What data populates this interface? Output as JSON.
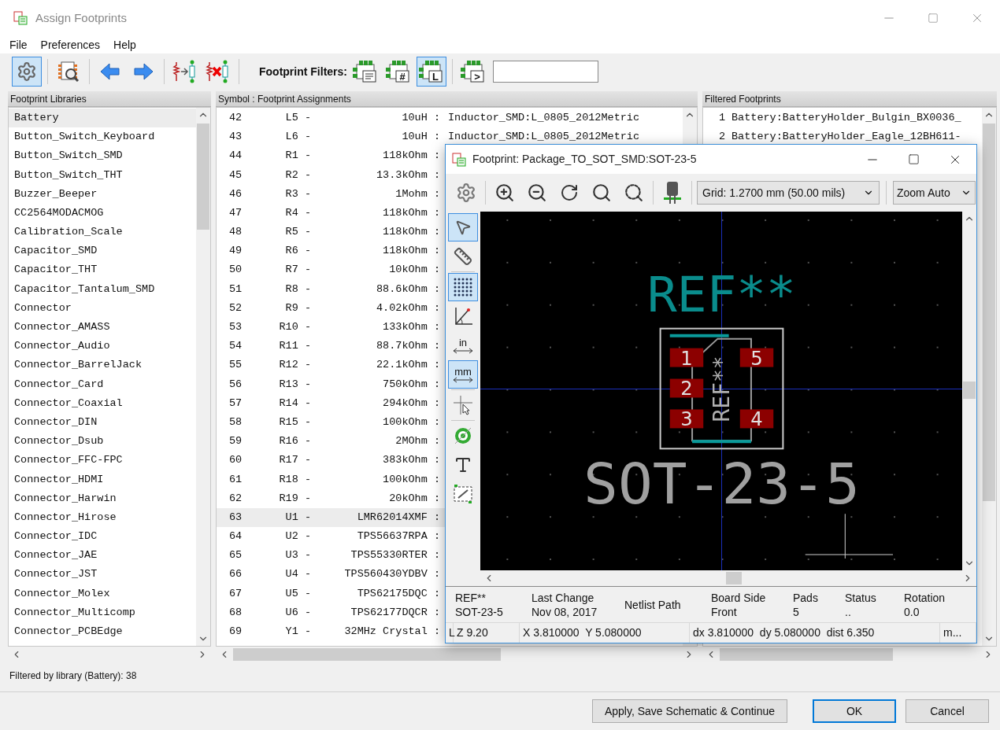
{
  "window": {
    "title": "Assign Footprints"
  },
  "menu": [
    "File",
    "Preferences",
    "Help"
  ],
  "toolbar": {
    "buttons": [
      {
        "kind": "settings",
        "selected": true
      },
      {
        "kind": "viewer",
        "selected": false
      },
      {
        "kind": "previous",
        "selected": false
      },
      {
        "kind": "next",
        "selected": false
      },
      {
        "kind": "associate",
        "selected": false
      },
      {
        "kind": "delete",
        "selected": false
      }
    ],
    "filter_label": "Footprint Filters:",
    "filters": [
      {
        "kind": "lines",
        "selected": false
      },
      {
        "kind": "glyph",
        "glyph": "#",
        "selected": false
      },
      {
        "kind": "glyph",
        "glyph": "L",
        "selected": true
      },
      {
        "kind": "glyph",
        "glyph": ">",
        "selected": false
      }
    ]
  },
  "libraries": {
    "header": "Footprint Libraries",
    "items": [
      {
        "name": "Battery",
        "selected": true
      },
      {
        "name": "Button_Switch_Keyboard",
        "selected": false
      },
      {
        "name": "Button_Switch_SMD",
        "selected": false
      },
      {
        "name": "Button_Switch_THT",
        "selected": false
      },
      {
        "name": "Buzzer_Beeper",
        "selected": false
      },
      {
        "name": "CC2564MODACMOG",
        "selected": false
      },
      {
        "name": "Calibration_Scale",
        "selected": false
      },
      {
        "name": "Capacitor_SMD",
        "selected": false
      },
      {
        "name": "Capacitor_THT",
        "selected": false
      },
      {
        "name": "Capacitor_Tantalum_SMD",
        "selected": false
      },
      {
        "name": "Connector",
        "selected": false
      },
      {
        "name": "Connector_AMASS",
        "selected": false
      },
      {
        "name": "Connector_Audio",
        "selected": false
      },
      {
        "name": "Connector_BarrelJack",
        "selected": false
      },
      {
        "name": "Connector_Card",
        "selected": false
      },
      {
        "name": "Connector_Coaxial",
        "selected": false
      },
      {
        "name": "Connector_DIN",
        "selected": false
      },
      {
        "name": "Connector_Dsub",
        "selected": false
      },
      {
        "name": "Connector_FFC-FPC",
        "selected": false
      },
      {
        "name": "Connector_HDMI",
        "selected": false
      },
      {
        "name": "Connector_Harwin",
        "selected": false
      },
      {
        "name": "Connector_Hirose",
        "selected": false
      },
      {
        "name": "Connector_IDC",
        "selected": false
      },
      {
        "name": "Connector_JAE",
        "selected": false
      },
      {
        "name": "Connector_JST",
        "selected": false
      },
      {
        "name": "Connector_Molex",
        "selected": false
      },
      {
        "name": "Connector_Multicomp",
        "selected": false
      },
      {
        "name": "Connector_PCBEdge",
        "selected": false
      }
    ]
  },
  "assignments": {
    "header": "Symbol : Footprint Assignments",
    "rows": [
      {
        "index": "42",
        "ref": "L5 -",
        "value": "10uH :",
        "footprint": "Inductor_SMD:L_0805_2012Metric",
        "selected": false
      },
      {
        "index": "43",
        "ref": "L6 -",
        "value": "10uH :",
        "footprint": "Inductor_SMD:L_0805_2012Metric",
        "selected": false
      },
      {
        "index": "44",
        "ref": "R1 -",
        "value": "118kOhm :",
        "selected": false
      },
      {
        "index": "45",
        "ref": "R2 -",
        "value": "13.3kOhm :",
        "selected": false
      },
      {
        "index": "46",
        "ref": "R3 -",
        "value": "1Mohm :",
        "selected": false
      },
      {
        "index": "47",
        "ref": "R4 -",
        "value": "118kOhm :",
        "selected": false
      },
      {
        "index": "48",
        "ref": "R5 -",
        "value": "118kOhm :",
        "selected": false
      },
      {
        "index": "49",
        "ref": "R6 -",
        "value": "118kOhm :",
        "selected": false
      },
      {
        "index": "50",
        "ref": "R7 -",
        "value": "10kOhm :",
        "selected": false
      },
      {
        "index": "51",
        "ref": "R8 -",
        "value": "88.6kOhm :",
        "selected": false
      },
      {
        "index": "52",
        "ref": "R9 -",
        "value": "4.02kOhm :",
        "selected": false
      },
      {
        "index": "53",
        "ref": "R10 -",
        "value": "133kOhm :",
        "selected": false
      },
      {
        "index": "54",
        "ref": "R11 -",
        "value": "88.7kOhm :",
        "selected": false
      },
      {
        "index": "55",
        "ref": "R12 -",
        "value": "22.1kOhm :",
        "selected": false
      },
      {
        "index": "56",
        "ref": "R13 -",
        "value": "750kOhm :",
        "selected": false
      },
      {
        "index": "57",
        "ref": "R14 -",
        "value": "294kOhm :",
        "selected": false
      },
      {
        "index": "58",
        "ref": "R15 -",
        "value": "100kOhm :",
        "selected": false
      },
      {
        "index": "59",
        "ref": "R16 -",
        "value": "2MOhm :",
        "selected": false
      },
      {
        "index": "60",
        "ref": "R17 -",
        "value": "383kOhm :",
        "selected": false
      },
      {
        "index": "61",
        "ref": "R18 -",
        "value": "100kOhm :",
        "selected": false
      },
      {
        "index": "62",
        "ref": "R19 -",
        "value": "20kOhm :",
        "selected": false
      },
      {
        "index": "63",
        "ref": "U1 -",
        "value": "LMR62014XMF :",
        "selected": true
      },
      {
        "index": "64",
        "ref": "U2 -",
        "value": "TPS56637RPA :",
        "selected": false
      },
      {
        "index": "65",
        "ref": "U3 -",
        "value": "TPS55330RTER :",
        "selected": false
      },
      {
        "index": "66",
        "ref": "U4 -",
        "value": "TPS560430YDBV :",
        "selected": false
      },
      {
        "index": "67",
        "ref": "U5 -",
        "value": "TPS62175DQC :",
        "selected": false
      },
      {
        "index": "68",
        "ref": "U6 -",
        "value": "TPS62177DQCR :",
        "selected": false
      },
      {
        "index": "69",
        "ref": "Y1 -",
        "value": "32MHz Crystal :",
        "selected": false
      }
    ]
  },
  "filtered": {
    "header": "Filtered Footprints",
    "rows": [
      {
        "index": "1",
        "name": "Battery:BatteryHolder_Bulgin_BX0036_"
      },
      {
        "index": "2",
        "name": "Battery:BatteryHolder_Eagle_12BH611-"
      }
    ]
  },
  "status_text": "Filtered by library (Battery): 38",
  "buttons": [
    {
      "label": "Apply, Save Schematic & Continue",
      "default": false
    },
    {
      "label": "OK",
      "default": true
    },
    {
      "label": "Cancel",
      "default": false
    }
  ],
  "viewer": {
    "title": "Footprint: Package_TO_SOT_SMD:SOT-23-5",
    "toolbar": [
      {
        "kind": "settings"
      },
      {
        "kind": "zoom_in"
      },
      {
        "kind": "zoom_out"
      },
      {
        "kind": "redraw"
      },
      {
        "kind": "zoom_fit"
      },
      {
        "kind": "zoom_area"
      },
      {
        "kind": "view_3d"
      }
    ],
    "grid": "Grid: 1.2700 mm (50.00 mils)",
    "zoom": "Zoom Auto",
    "tools": [
      {
        "kind": "pointer",
        "selected": true
      },
      {
        "kind": "measure",
        "selected": false
      },
      {
        "kind": "grid",
        "selected": true
      },
      {
        "kind": "polar",
        "selected": false
      },
      {
        "kind": "units",
        "label": "in",
        "selected": false
      },
      {
        "kind": "units",
        "label": "mm",
        "selected": true
      },
      {
        "kind": "cursor",
        "selected": false
      },
      {
        "kind": "pads",
        "selected": false
      },
      {
        "kind": "text",
        "selected": false
      },
      {
        "kind": "outline",
        "selected": false
      }
    ],
    "canvas": {
      "reference": "REF**",
      "value": "SOT-23-5",
      "fab_reference": "REF**",
      "pads": [
        "1",
        "2",
        "3",
        "5",
        "4"
      ]
    },
    "info": [
      {
        "label": "REF**",
        "value": "SOT-23-5"
      },
      {
        "label": "Last Change",
        "value": "Nov 08, 2017"
      },
      {
        "label": "Netlist Path"
      },
      {
        "label": "Board Side",
        "value": "Front"
      },
      {
        "label": "Pads",
        "value": "5"
      },
      {
        "label": "Status",
        "value": ".."
      },
      {
        "label": "Rotation",
        "value": "0.0"
      }
    ],
    "status_bar": [
      "L",
      "Z 9.20",
      "X 3.810000  Y 5.080000",
      "dx 3.810000  dy 5.080000  dist 6.350",
      "m..."
    ]
  }
}
